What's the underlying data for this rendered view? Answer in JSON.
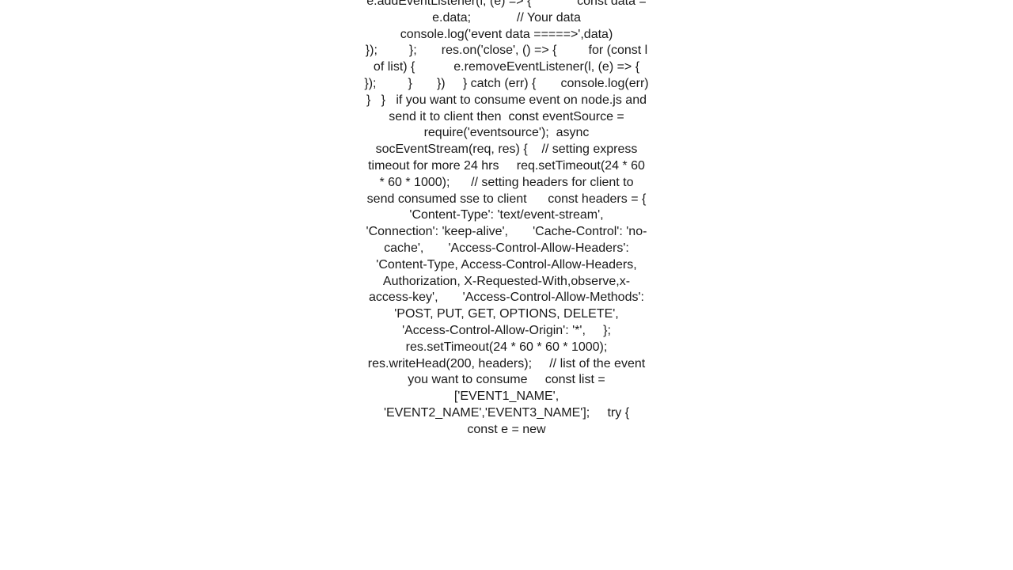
{
  "content": "e.addEventListener(l, (e) => {             const data = e.data;             // Your data             console.log('event data =====>',data)                       });         };       res.on('close', () => {         for (const l of list) {           e.removeEventListener(l, (e) => {           });         }       })     } catch (err) {       console.log(err)     }   }   if you want to consume event on node.js and send it to client then  const eventSource = require('eventsource');  async socEventStream(req, res) {    // setting express timeout for more 24 hrs     req.setTimeout(24 * 60 * 60 * 1000);      // setting headers for client to send consumed sse to client      const headers = {       'Content-Type': 'text/event-stream',       'Connection': 'keep-alive',       'Cache-Control': 'no-cache',       'Access-Control-Allow-Headers': 'Content-Type, Access-Control-Allow-Headers, Authorization, X-Requested-With,observe,x-access-key',       'Access-Control-Allow-Methods': 'POST, PUT, GET, OPTIONS, DELETE',       'Access-Control-Allow-Origin': '*',     };     res.setTimeout(24 * 60 * 60 * 1000);     res.writeHead(200, headers);     // list of the event you want to consume     const list = ['EVENT1_NAME', 'EVENT2_NAME','EVENT3_NAME'];     try {       const e = new"
}
